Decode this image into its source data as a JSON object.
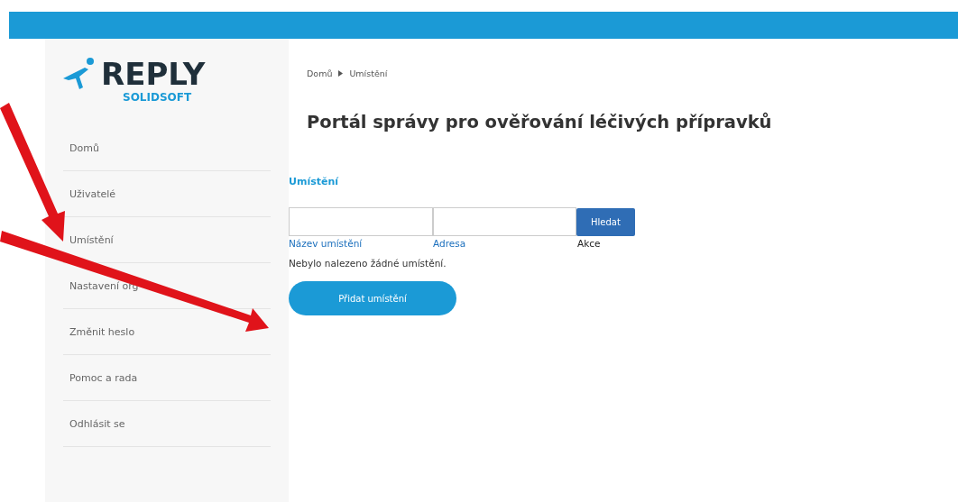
{
  "logo": {
    "name": "REPLY",
    "subtitle": "SOLIDSOFT"
  },
  "sidebar": {
    "items": [
      {
        "label": "Domů",
        "selected": false
      },
      {
        "label": "Uživatelé",
        "selected": false
      },
      {
        "label": "Umístění",
        "selected": false
      },
      {
        "label": "Nastavení org",
        "selected": false
      },
      {
        "label": "Změnit heslo",
        "selected": false
      },
      {
        "label": "Pomoc a rada",
        "selected": false
      },
      {
        "label": "Odhlásit se",
        "selected": false
      }
    ]
  },
  "breadcrumb": [
    "Domů",
    "Umístění"
  ],
  "title": "Portál správy pro ověřování léčivých přípravků",
  "section_link": "Umístění",
  "search": {
    "button": "Hledat",
    "columns": [
      "Název umístění",
      "Adresa",
      "Akce"
    ]
  },
  "empty_message": "Nebylo nalezeno žádné umístění.",
  "add_button": "Přidat umístění"
}
